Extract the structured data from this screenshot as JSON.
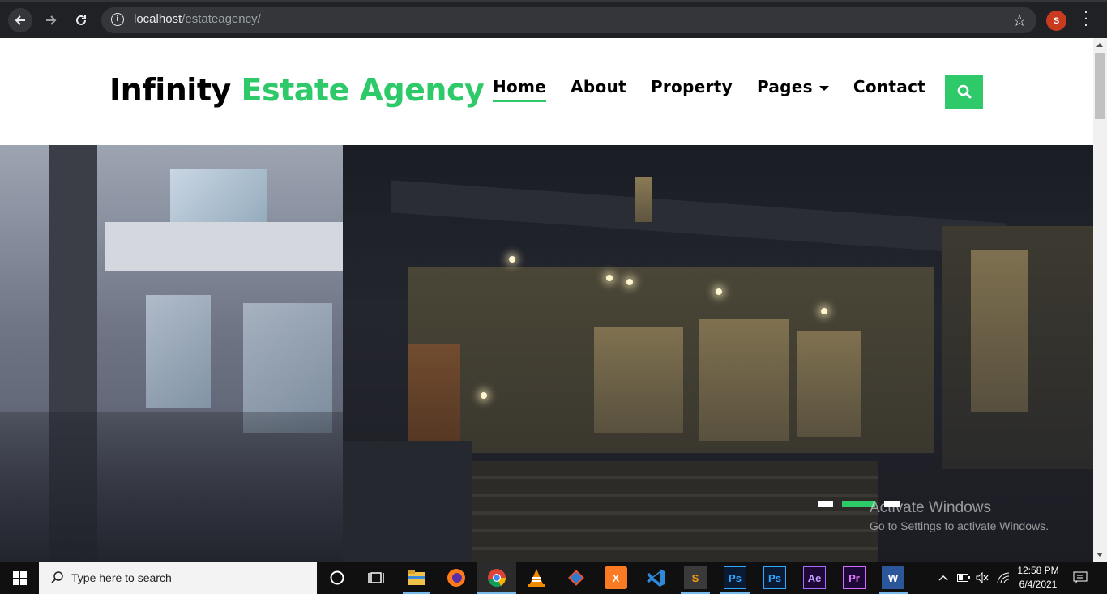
{
  "browser": {
    "url_host": "localhost",
    "url_path": "/estateagency/",
    "profile_initial": "S"
  },
  "site": {
    "logo_part1": "Infinity",
    "logo_part2": "Estate Agency",
    "nav": [
      {
        "label": "Home",
        "active": true
      },
      {
        "label": "About",
        "active": false
      },
      {
        "label": "Property",
        "active": false
      },
      {
        "label": "Pages",
        "active": false,
        "dropdown": true
      },
      {
        "label": "Contact",
        "active": false
      }
    ],
    "accent_color": "#2eca6a"
  },
  "carousel": {
    "slide_count": 3,
    "active_index": 1
  },
  "watermark": {
    "line1": "Activate Windows",
    "line2": "Go to Settings to activate Windows."
  },
  "taskbar": {
    "search_placeholder": "Type here to search",
    "apps": [
      "cortana-icon",
      "task-view-icon",
      "file-explorer-icon",
      "firefox-icon",
      "chrome-icon",
      "vlc-icon",
      "git-icon",
      "xampp-icon",
      "vscode-icon",
      "sublime-icon",
      "photoshop-icon",
      "photoshop-icon-2",
      "after-effects-icon",
      "premiere-icon",
      "word-icon"
    ],
    "time": "12:58 PM",
    "date": "6/4/2021"
  }
}
